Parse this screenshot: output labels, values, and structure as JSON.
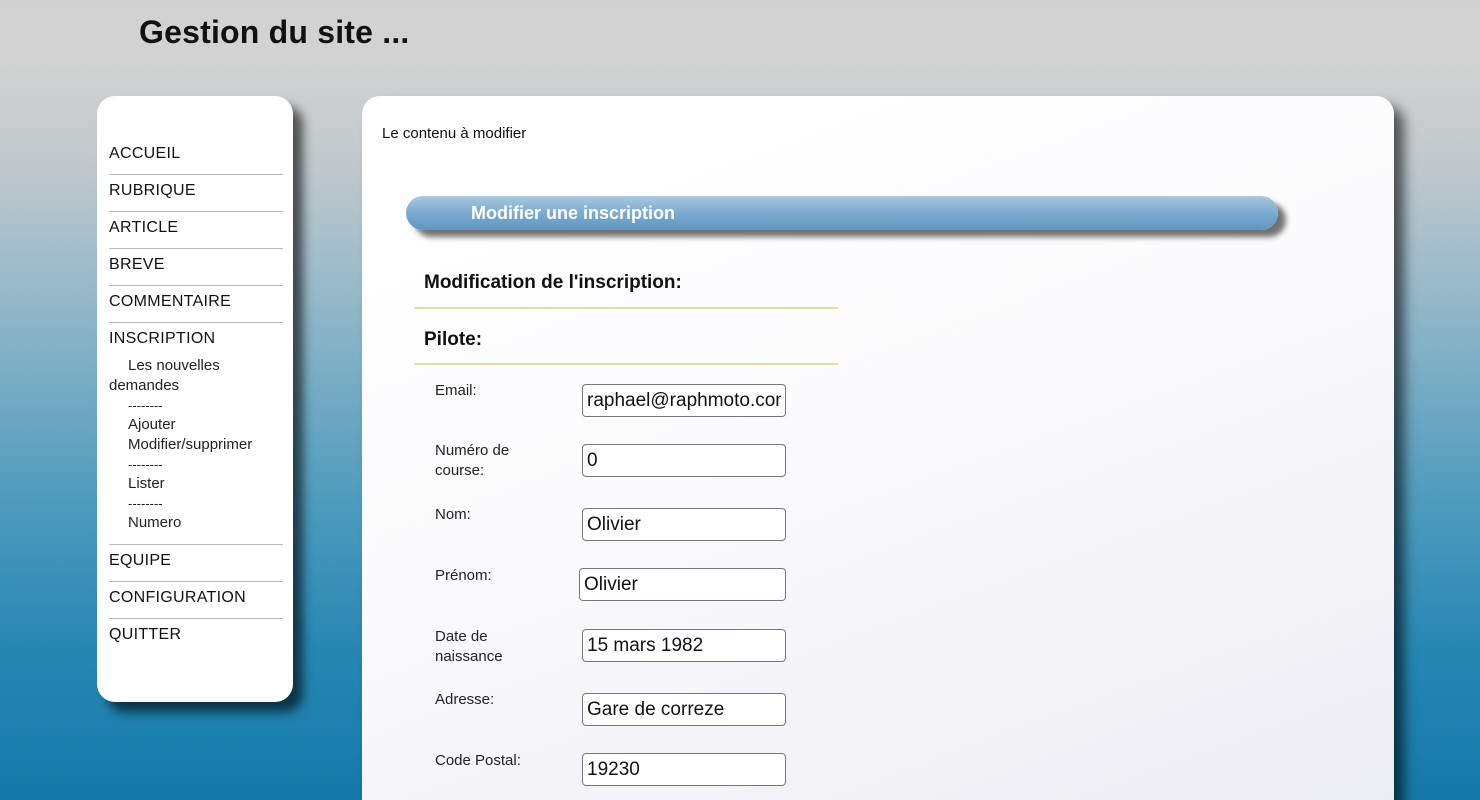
{
  "header": {
    "title": "Gestion du site ..."
  },
  "sidebar": {
    "items": [
      {
        "label": "ACCUEIL"
      },
      {
        "label": "RUBRIQUE"
      },
      {
        "label": "ARTICLE"
      },
      {
        "label": "BREVE"
      },
      {
        "label": "COMMENTAIRE"
      },
      {
        "label": "INSCRIPTION",
        "sub": {
          "nouvelles": "Les nouvelles demandes",
          "sep1": "--------",
          "ajouter": "Ajouter",
          "modifier": "Modifier/supprimer",
          "sep2": "--------",
          "lister": "Lister",
          "sep3": "--------",
          "numero": "Numero"
        }
      },
      {
        "label": "EQUIPE"
      },
      {
        "label": "CONFIGURATION"
      },
      {
        "label": "QUITTER"
      }
    ]
  },
  "main": {
    "caption": "Le contenu à modifier",
    "form_title": "Modifier une inscription",
    "section_modification": "Modification de l'inscription:",
    "section_pilote": "Pilote:",
    "fields": [
      {
        "label": "Email:",
        "value": "raphael@raphmoto.com"
      },
      {
        "label": "Numéro de course:",
        "value": "0"
      },
      {
        "label": "Nom:",
        "value": "Olivier"
      },
      {
        "label": "Prénom:",
        "value": "Olivier"
      },
      {
        "label": "Date de naissance",
        "value": "15 mars 1982"
      },
      {
        "label": "Adresse:",
        "value": "Gare de correze"
      },
      {
        "label": "Code Postal:",
        "value": "19230"
      }
    ]
  }
}
